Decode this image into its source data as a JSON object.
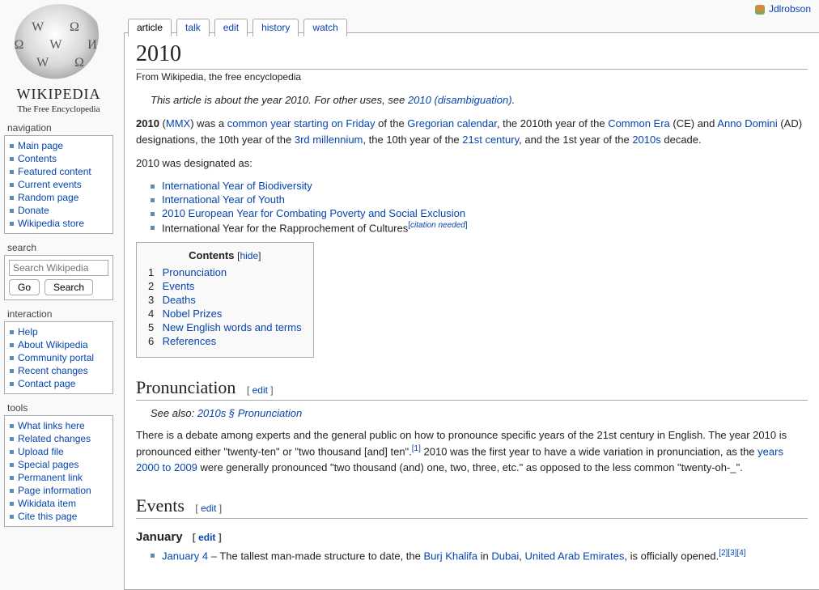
{
  "logo": {
    "name": "WIKIPEDIA",
    "tagline": "The Free Encyclopedia"
  },
  "user": {
    "name": "Jdlrobson"
  },
  "tabs": {
    "article": "article",
    "talk": "talk",
    "edit": "edit",
    "history": "history",
    "watch": "watch"
  },
  "nav": {
    "heading": "navigation",
    "items": [
      "Main page",
      "Contents",
      "Featured content",
      "Current events",
      "Random page",
      "Donate",
      "Wikipedia store"
    ]
  },
  "search": {
    "heading": "search",
    "placeholder": "Search Wikipedia",
    "go": "Go",
    "search": "Search"
  },
  "interaction": {
    "heading": "interaction",
    "items": [
      "Help",
      "About Wikipedia",
      "Community portal",
      "Recent changes",
      "Contact page"
    ]
  },
  "tools": {
    "heading": "tools",
    "items": [
      "What links here",
      "Related changes",
      "Upload file",
      "Special pages",
      "Permanent link",
      "Page information",
      "Wikidata item",
      "Cite this page"
    ]
  },
  "article": {
    "title": "2010",
    "subtitle": "From Wikipedia, the free encyclopedia",
    "hatnote_prefix": "This article is about the year 2010. For other uses, see ",
    "hatnote_link": "2010 (disambiguation)",
    "lead": {
      "p1a": "2010",
      "p1b": " (",
      "mmx": "MMX",
      "p1c": ") was a ",
      "link_commonyear": "common year starting on Friday",
      "p1d": " of the ",
      "link_gregorian": "Gregorian calendar",
      "p1e": ", the 2010th year of the ",
      "link_commonera": "Common Era",
      "p1f": " (CE) and ",
      "link_ad": "Anno Domini",
      "p1g": " (AD) designations, the 10th year of the ",
      "link_3rdmil": "3rd millennium",
      "p1h": ", the 10th year of the ",
      "link_21st": "21st century",
      "p1i": ", and the 1st year of the ",
      "link_2010s": "2010s",
      "p1j": " decade."
    },
    "designated_intro": "2010 was designated as:",
    "designated": {
      "d1": "International Year of Biodiversity",
      "d2": "International Year of Youth",
      "d3": "2010 European Year for Combating Poverty and Social Exclusion",
      "d4": "International Year for the Rapprochement of Cultures",
      "cn": "citation needed"
    },
    "toc": {
      "title": "Contents",
      "hide": "hide",
      "items": [
        "Pronunciation",
        "Events",
        "Deaths",
        "Nobel Prizes",
        "New English words and terms",
        "References"
      ]
    },
    "edit_label": "edit",
    "pronunciation": {
      "heading": "Pronunciation",
      "seealso_prefix": "See also: ",
      "seealso_link": "2010s § Pronunciation",
      "body_a": "There is a debate among experts and the general public on how to pronounce specific years of the 21st century in English. The year 2010 is pronounced either \"twenty-ten\" or \"two thousand [and] ten\".",
      "ref1": "[1]",
      "body_b": " 2010 was the first year to have a wide variation in pronunciation, as the ",
      "body_link": "years 2000 to 2009",
      "body_c": " were generally pronounced \"two thousand (and) one, two, three, etc.\" as opposed to the less common \"twenty-oh-_\"."
    },
    "events": {
      "heading": "Events",
      "january": "January",
      "j4_date": "January 4",
      "j4_a": " – The tallest man-made structure to date, the ",
      "j4_burj": "Burj Khalifa",
      "j4_b": " in ",
      "j4_dubai": "Dubai",
      "j4_c": ", ",
      "j4_uae": "United Arab Emirates",
      "j4_d": ", is officially opened.",
      "j4_refs": "[2][3][4]"
    }
  }
}
